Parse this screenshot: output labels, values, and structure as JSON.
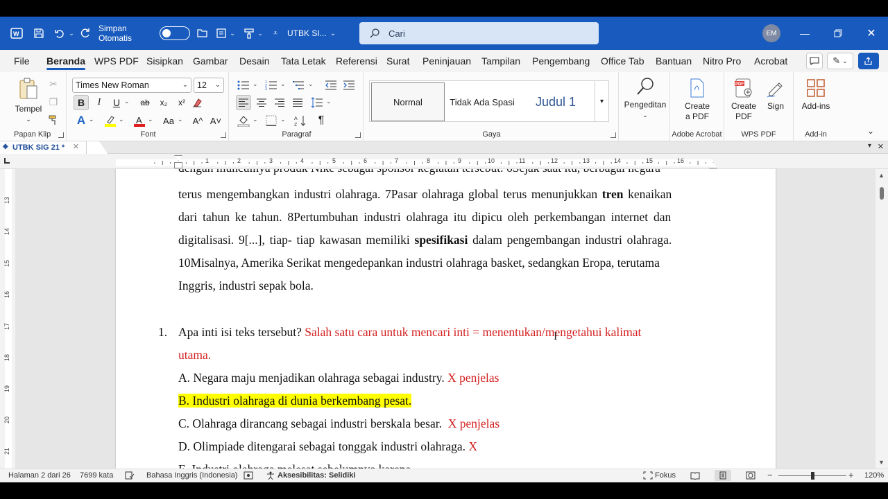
{
  "titlebar": {
    "autosave_label": "Simpan Otomatis",
    "filename": "UTBK SI...",
    "search_placeholder": "Cari",
    "user_initials": "EM"
  },
  "menu": {
    "tabs": [
      "File",
      "Beranda",
      "WPS PDF",
      "Sisipkan",
      "Gambar",
      "Desain",
      "Tata Letak",
      "Referensi",
      "Surat",
      "Peninjauan",
      "Tampilan",
      "Pengembang",
      "Office Tab",
      "Bantuan",
      "Nitro Pro",
      "Acrobat"
    ],
    "active_tab": "Beranda"
  },
  "ribbon": {
    "clipboard": {
      "paste_label": "Tempel",
      "group_label": "Papan Klip"
    },
    "font": {
      "family": "Times New Roman",
      "size": "12",
      "group_label": "Font",
      "bold": "B",
      "italic": "I",
      "underline": "U",
      "strike": "ab",
      "sub": "x₂",
      "sup": "x²",
      "case": "Aa",
      "grow": "A^",
      "shrink": "A˅"
    },
    "paragraph": {
      "group_label": "Paragraf",
      "pilcrow": "¶"
    },
    "styles": {
      "items": [
        "Normal",
        "Tidak Ada Spasi",
        "Judul 1"
      ],
      "group_label": "Gaya"
    },
    "editing": {
      "label": "Pengeditan"
    },
    "acrobat": {
      "create_label_1": "Create",
      "create_label_2": "a PDF",
      "group_label": "Adobe Acrobat"
    },
    "wps": {
      "create_label_1": "Create",
      "create_label_2": "PDF",
      "sign_label": "Sign",
      "group_label": "WPS PDF"
    },
    "addins": {
      "label": "Add-ins",
      "group_label": "Add-in"
    }
  },
  "doc_tab": {
    "title": "UTBK SIG 21 *"
  },
  "ruler": {
    "h_ticks": [
      "1",
      "1",
      "2",
      "3",
      "4",
      "5",
      "6",
      "7",
      "8",
      "9",
      "10",
      "11",
      "12",
      "13",
      "14",
      "15",
      "16"
    ],
    "v_ticks": [
      "13",
      "14",
      "15",
      "16",
      "17",
      "18",
      "19",
      "20",
      "21"
    ]
  },
  "document": {
    "p_top": "dengan munculnya produk Nike sebagai sponsor kegiatan tersebut. 6Sejak saat itu, berbagai negara",
    "p1": "terus mengembangkan industri olahraga. 7Pasar olahraga global terus menunjukkan ",
    "p1_bold": "tren",
    "p1_end": " kenaikan",
    "p2": "dari tahun ke tahun. 8Pertumbuhan industri olahraga itu dipicu oleh perkembangan internet dan",
    "p3": "digitalisasi. 9[...], tiap- tiap kawasan memiliki ",
    "p3_bold": "spesifikasi",
    "p3_end": " dalam pengembangan industri olahraga.",
    "p4": "10Misalnya, Amerika Serikat mengedepankan industri olahraga basket, sedangkan Eropa, terutama",
    "p5": "Inggris, industri sepak bola.",
    "q_num": "1.",
    "q_text": "Apa inti isi teks tersebut? ",
    "q_note": "Salah satu cara untuk mencari inti = menentukan/mengetahui kalimat",
    "q_note2": "utama.",
    "opt_a": "A. Negara maju menjadikan olahraga sebagai industry. ",
    "opt_a_note": "X penjelas",
    "opt_b": "B. Industri olahraga di dunia berkembang pesat.",
    "opt_c": "C. Olahraga dirancang sebagai industri berskala besar.  ",
    "opt_c_note": "X penjelas",
    "opt_d": "D. Olimpiade ditengarai sebagai tonggak industri olahraga. ",
    "opt_d_note": "X",
    "opt_e_partial": "E. Industri olahraga melesat sebelumnya karena..."
  },
  "status": {
    "page": "Halaman 2 dari 26",
    "words": "7699 kata",
    "language": "Bahasa Inggris (Indonesia)",
    "accessibility": "Aksesibilitas: Selidiki",
    "focus": "Fokus",
    "zoom": "120%"
  },
  "colors": {
    "accent": "#185abd",
    "annotation_red": "#d42020",
    "highlight": "#ffff00"
  }
}
